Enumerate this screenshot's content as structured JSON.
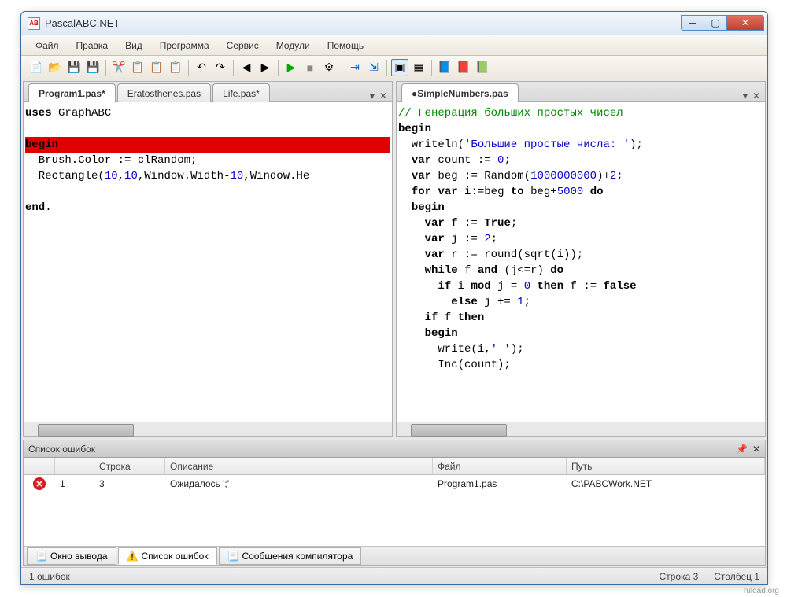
{
  "title": "PascalABC.NET",
  "menu": {
    "file": "Файл",
    "edit": "Правка",
    "view": "Вид",
    "program": "Программа",
    "service": "Сервис",
    "modules": "Модули",
    "help": "Помощь"
  },
  "leftTabs": {
    "t0": "Program1.pas*",
    "t1": "Eratosthenes.pas",
    "t2": "Life.pas*"
  },
  "rightTabs": {
    "t0": "●SimpleNumbers.pas"
  },
  "leftCode": {
    "l0": "uses GraphABC",
    "l1": "",
    "l2": "begin",
    "l3": "  Brush.Color := clRandom;",
    "l4": "  Rectangle(10,10,Window.Width-10,Window.He",
    "l5": "",
    "l6": "end."
  },
  "rightCode": {
    "c0": "// Генерация больших простых чисел",
    "k_begin": "begin",
    "l1a": "  writeln(",
    "l1s": "'Большие простые числа: '",
    "l1b": ");",
    "l2a": "  ",
    "l2k": "var",
    "l2b": " count := ",
    "l2n": "0",
    "l2c": ";",
    "l3a": "  ",
    "l3k": "var",
    "l3b": " beg := Random(",
    "l3n": "1000000000",
    "l3c": ")+",
    "l3n2": "2",
    "l3d": ";",
    "l4a": "  ",
    "l4k1": "for",
    "l4b": " ",
    "l4k2": "var",
    "l4c": " i:=beg ",
    "l4k3": "to",
    "l4d": " beg+",
    "l4n": "5000",
    "l4e": " ",
    "l4k4": "do",
    "l5a": "  ",
    "l5k": "begin",
    "l6a": "    ",
    "l6k": "var",
    "l6b": " f := ",
    "l6t": "True",
    "l6c": ";",
    "l7a": "    ",
    "l7k": "var",
    "l7b": " j := ",
    "l7n": "2",
    "l7c": ";",
    "l8a": "    ",
    "l8k": "var",
    "l8b": " r := round(sqrt(i));",
    "l9a": "    ",
    "l9k": "while",
    "l9b": " f ",
    "l9k2": "and",
    "l9c": " (j<=r) ",
    "l9k3": "do",
    "l10a": "      ",
    "l10k": "if",
    "l10b": " i ",
    "l10k2": "mod",
    "l10c": " j = ",
    "l10n": "0",
    "l10d": " ",
    "l10k3": "then",
    "l10e": " f := ",
    "l10f": "false",
    "l11a": "        ",
    "l11k": "else",
    "l11b": " j += ",
    "l11n": "1",
    "l11c": ";",
    "l12a": "    ",
    "l12k": "if",
    "l12b": " f ",
    "l12k2": "then",
    "l13a": "    ",
    "l13k": "begin",
    "l14a": "      write(i,",
    "l14s": "' '",
    "l14b": ");",
    "l15a": "      Inc(count);"
  },
  "errPanel": {
    "title": "Список ошибок",
    "cols": {
      "row": "Строка",
      "desc": "Описание",
      "file": "Файл",
      "path": "Путь"
    },
    "r0": {
      "num": "1",
      "row": "3",
      "desc": "Ожидалось ';'",
      "file": "Program1.pas",
      "path": "C:\\PABCWork.NET"
    }
  },
  "bottomTabs": {
    "t0": "Окно вывода",
    "t1": "Список ошибок",
    "t2": "Сообщения компилятора"
  },
  "status": {
    "left": "1 ошибок",
    "line": "Строка  3",
    "col": "Столбец  1"
  },
  "watermark": "ruload.org"
}
